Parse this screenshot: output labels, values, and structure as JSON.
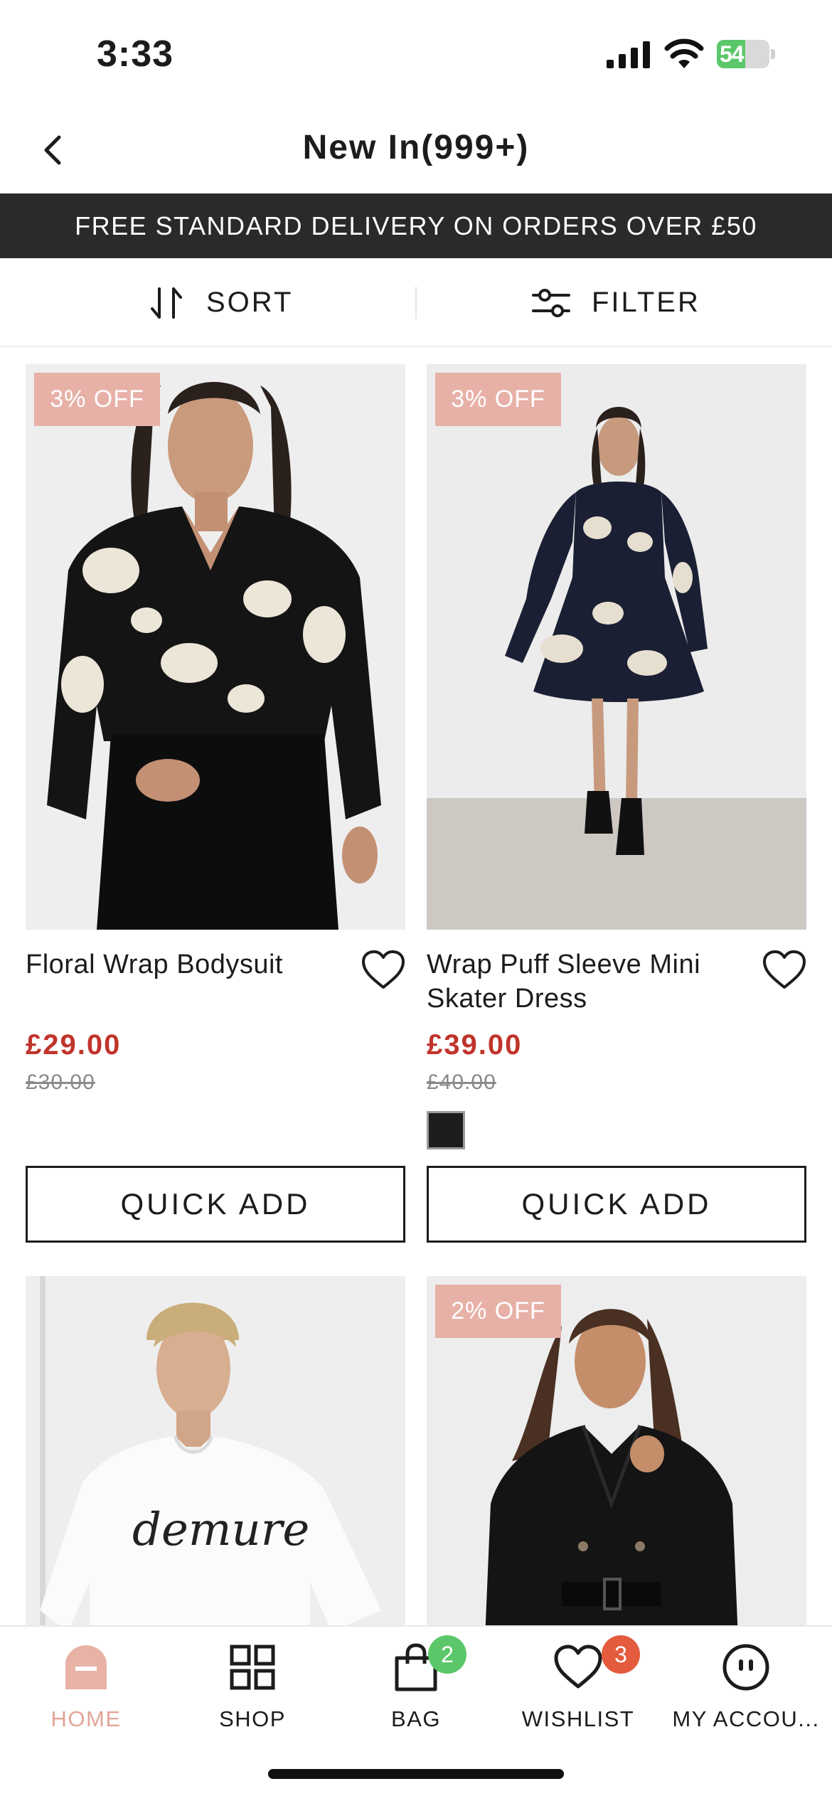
{
  "status_bar": {
    "time": "3:33",
    "battery": "54",
    "battery_level": 0.54
  },
  "header": {
    "title": "New In(999+)"
  },
  "promo": {
    "text": "FREE STANDARD DELIVERY ON ORDERS OVER £50"
  },
  "toolbar": {
    "sort_label": "SORT",
    "filter_label": "FILTER"
  },
  "products": [
    {
      "badge": "3% OFF",
      "name": "Floral Wrap Bodysuit",
      "price": "£29.00",
      "was_price": "£30.00",
      "quick_add": "QUICK ADD",
      "image_icon": "floral-bodysuit"
    },
    {
      "badge": "3% OFF",
      "name": "Wrap Puff Sleeve Mini Skater Dress",
      "price": "£39.00",
      "was_price": "£40.00",
      "swatch_color": "#1d1d1d",
      "quick_add": "QUICK ADD",
      "image_icon": "floral-dress"
    },
    {
      "badge": "",
      "name": "",
      "image_icon": "white-tshirt",
      "tshirt_print": "demure"
    },
    {
      "badge": "2% OFF",
      "name": "",
      "image_icon": "black-trench-coat"
    }
  ],
  "tabbar": {
    "items": [
      {
        "label": "HOME",
        "active": true
      },
      {
        "label": "SHOP"
      },
      {
        "label": "BAG",
        "badge": "2"
      },
      {
        "label": "WISHLIST",
        "badge": "3"
      },
      {
        "label": "MY ACCOU..."
      }
    ]
  },
  "colors": {
    "accent": "#e7b1a8",
    "sale_price": "#c0342b",
    "bag_badge": "#5cc76a",
    "wishlist_badge": "#e45b3e",
    "banner": "#2a2a2a"
  }
}
